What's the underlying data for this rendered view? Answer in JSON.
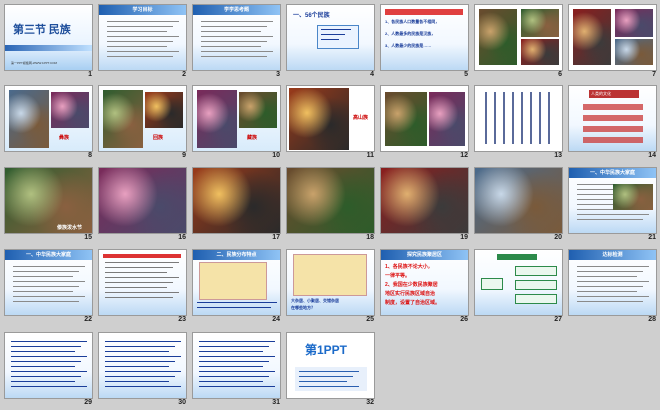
{
  "slides": [
    {
      "num": "1",
      "title": "第三节  民族",
      "subtitle": "第一PPT模板网-WWW.1PPT.COM"
    },
    {
      "num": "2",
      "title": "学习目标"
    },
    {
      "num": "3",
      "title": "学学思考题"
    },
    {
      "num": "4",
      "title": "一、56个民族"
    },
    {
      "num": "5"
    },
    {
      "num": "6"
    },
    {
      "num": "7"
    },
    {
      "num": "8",
      "caption": "彝族"
    },
    {
      "num": "9",
      "caption": "回族"
    },
    {
      "num": "10",
      "caption": "藏族"
    },
    {
      "num": "11",
      "caption": "高山族"
    },
    {
      "num": "12"
    },
    {
      "num": "13"
    },
    {
      "num": "14",
      "title": "人类的文化"
    },
    {
      "num": "15",
      "caption": "傣族泼水节"
    },
    {
      "num": "16"
    },
    {
      "num": "17"
    },
    {
      "num": "18"
    },
    {
      "num": "19"
    },
    {
      "num": "20"
    },
    {
      "num": "21",
      "title": "一、中华民族大家庭"
    },
    {
      "num": "22",
      "title": "一、中华民族大家庭"
    },
    {
      "num": "23"
    },
    {
      "num": "24",
      "title": "二、民族分布特点"
    },
    {
      "num": "25"
    },
    {
      "num": "26",
      "title": "探究民族聚居区"
    },
    {
      "num": "27"
    },
    {
      "num": "28",
      "title": "达标检测"
    },
    {
      "num": "29"
    },
    {
      "num": "30"
    },
    {
      "num": "31"
    },
    {
      "num": "32",
      "logo": "第1PPT"
    }
  ],
  "slide5": {
    "lines": [
      "1、各民族人口数量各不相同，",
      "2、人数最多的民族是汉族，",
      "3、人数最少的民族是……"
    ]
  },
  "slide26": {
    "lines": [
      "1、各民族不论大小，",
      "一律平等。",
      "2、我国在少数民族聚居",
      "地区实行民族区域自治",
      "制度，设置了自治区域。"
    ]
  },
  "slide25": {
    "lines": [
      "大杂居、小聚居、交错杂居",
      "在哪些地方？"
    ]
  },
  "colors": {
    "accent": "#1f5fb0",
    "red": "#d22222",
    "bg": "#cfcfcf"
  }
}
